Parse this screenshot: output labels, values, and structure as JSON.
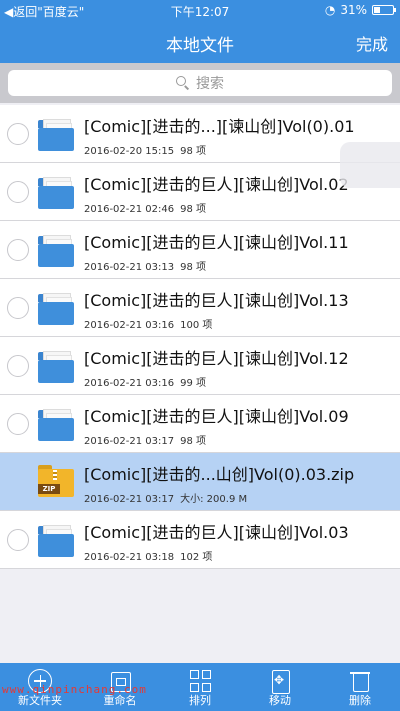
{
  "status_bar": {
    "back_label": "◀返回\"百度云\"",
    "time": "下午12:07",
    "battery": "31%",
    "battery_level": 0.31
  },
  "nav": {
    "title": "本地文件",
    "done_label": "完成"
  },
  "search": {
    "placeholder": "搜索"
  },
  "files": [
    {
      "name": "[Comic][进击的...][谏山创]Vol(0).01",
      "date": "2016-02-20 15:15",
      "info": "98 项",
      "type": "folder"
    },
    {
      "name": "[Comic][进击的巨人][谏山创]Vol.02",
      "date": "2016-02-21 02:46",
      "info": "98 项",
      "type": "folder"
    },
    {
      "name": "[Comic][进击的巨人][谏山创]Vol.11",
      "date": "2016-02-21 03:13",
      "info": "98 项",
      "type": "folder"
    },
    {
      "name": "[Comic][进击的巨人][谏山创]Vol.13",
      "date": "2016-02-21 03:16",
      "info": "100 项",
      "type": "folder"
    },
    {
      "name": "[Comic][进击的巨人][谏山创]Vol.12",
      "date": "2016-02-21 03:16",
      "info": "99 项",
      "type": "folder"
    },
    {
      "name": "[Comic][进击的巨人][谏山创]Vol.09",
      "date": "2016-02-21 03:17",
      "info": "98 项",
      "type": "folder"
    },
    {
      "name": "[Comic][进击的...山创]Vol(0).03.zip",
      "date": "2016-02-21 03:17",
      "info": "大小: 200.9 M",
      "type": "zip",
      "zip_label": "ZIP"
    },
    {
      "name": "[Comic][进击的巨人][谏山创]Vol.03",
      "date": "2016-02-21 03:18",
      "info": "102 项",
      "type": "folder"
    }
  ],
  "toolbar": {
    "new_folder": "新文件夹",
    "rename": "重命名",
    "sort": "排列",
    "move": "移动",
    "delete": "删除"
  },
  "watermark": "www.qinpinchang.com",
  "colors": {
    "accent": "#3b8fe0",
    "selected_row": "#b6d2f4",
    "folder": "#3f8fdb",
    "zip": "#f2b52a"
  }
}
